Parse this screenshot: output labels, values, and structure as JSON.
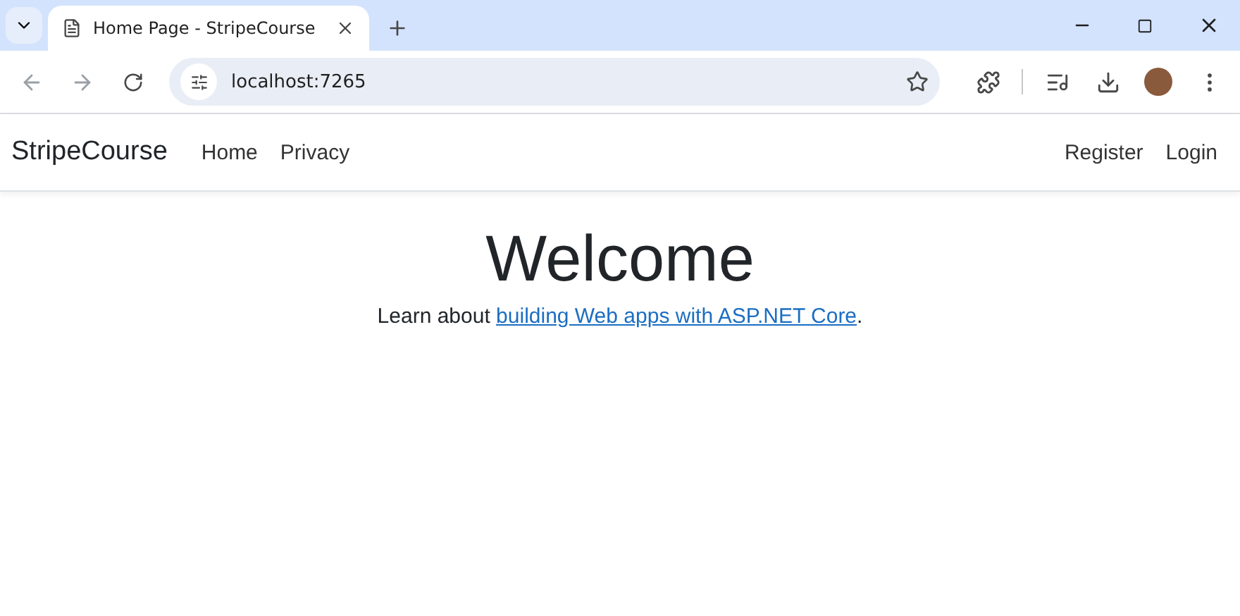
{
  "browser": {
    "tabs": [
      {
        "title": "Home Page - StripeCourse",
        "selected": true
      }
    ],
    "address": "localhost:7265"
  },
  "navbar": {
    "brand": "StripeCourse",
    "links": [
      "Home",
      "Privacy"
    ],
    "account_links": [
      "Register",
      "Login"
    ]
  },
  "main": {
    "heading": "Welcome",
    "lead": {
      "before": "Learn about ",
      "link": "building Web apps with ASP.NET Core",
      "after": "."
    }
  }
}
